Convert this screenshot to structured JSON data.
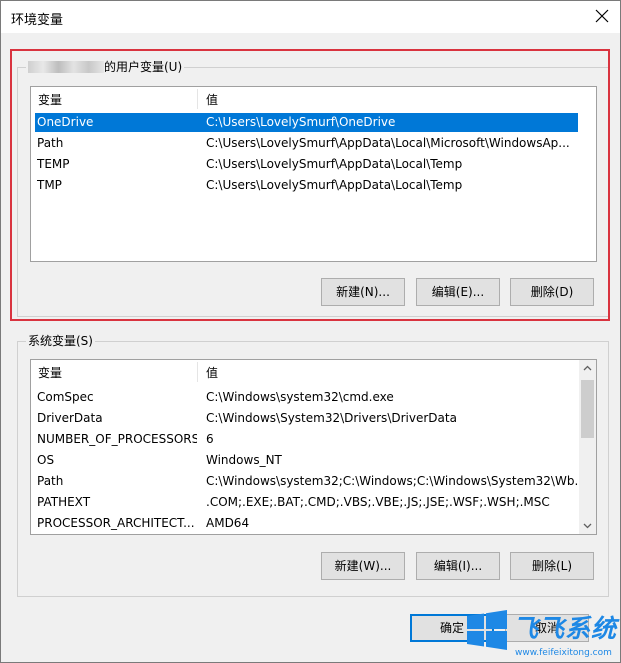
{
  "window": {
    "title": "环境变量"
  },
  "user_vars": {
    "title_suffix": "的用户变量(U)",
    "col_name": "变量",
    "col_value": "值",
    "rows": [
      {
        "name": "OneDrive",
        "value": "C:\\Users\\LovelySmurf\\OneDrive"
      },
      {
        "name": "Path",
        "value": "C:\\Users\\LovelySmurf\\AppData\\Local\\Microsoft\\WindowsAp..."
      },
      {
        "name": "TEMP",
        "value": "C:\\Users\\LovelySmurf\\AppData\\Local\\Temp"
      },
      {
        "name": "TMP",
        "value": "C:\\Users\\LovelySmurf\\AppData\\Local\\Temp"
      }
    ],
    "new_label": "新建(N)...",
    "edit_label": "编辑(E)...",
    "delete_label": "删除(D)"
  },
  "sys_vars": {
    "title": "系统变量(S)",
    "col_name": "变量",
    "col_value": "值",
    "rows": [
      {
        "name": "ComSpec",
        "value": "C:\\Windows\\system32\\cmd.exe"
      },
      {
        "name": "DriverData",
        "value": "C:\\Windows\\System32\\Drivers\\DriverData"
      },
      {
        "name": "NUMBER_OF_PROCESSORS",
        "value": "6"
      },
      {
        "name": "OS",
        "value": "Windows_NT"
      },
      {
        "name": "Path",
        "value": "C:\\Windows\\system32;C:\\Windows;C:\\Windows\\System32\\Wb..."
      },
      {
        "name": "PATHEXT",
        "value": ".COM;.EXE;.BAT;.CMD;.VBS;.VBE;.JS;.JSE;.WSF;.WSH;.MSC"
      },
      {
        "name": "PROCESSOR_ARCHITECT...",
        "value": "AMD64"
      }
    ],
    "new_label": "新建(W)...",
    "edit_label": "编辑(I)...",
    "delete_label": "删除(L)"
  },
  "footer": {
    "ok_label": "确定",
    "cancel_label": "取消"
  },
  "watermark": {
    "brand": "飞飞系统",
    "url": "www.feifeixitong.com"
  },
  "colors": {
    "selection": "#0078d7",
    "highlight": "#d9333f",
    "logo_blue": "#1e88e5"
  }
}
